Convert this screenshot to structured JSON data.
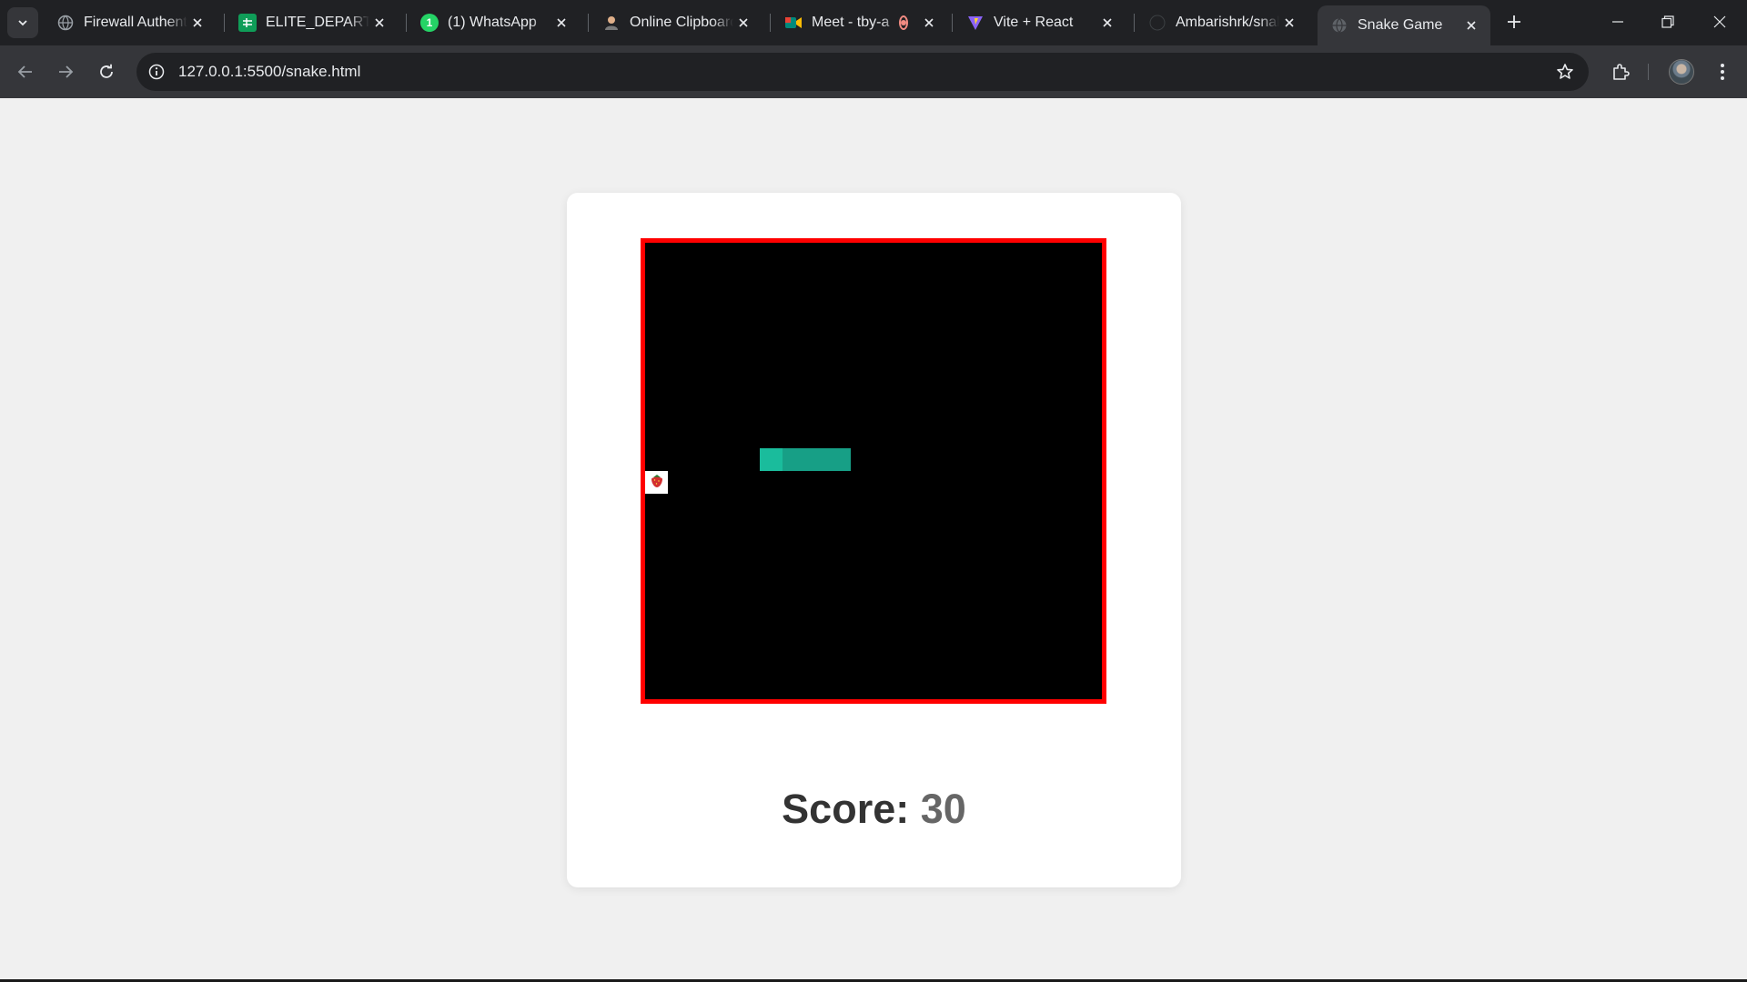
{
  "browser": {
    "tabs": [
      {
        "title": "Firewall Authenti",
        "favicon": "globe-icon",
        "active": false
      },
      {
        "title": "ELITE_DEPARTME",
        "favicon": "sheets-icon",
        "active": false
      },
      {
        "title": "(1) WhatsApp",
        "favicon": "whatsapp-icon",
        "active": false
      },
      {
        "title": "Online Clipboard",
        "favicon": "person-icon",
        "active": false
      },
      {
        "title": "Meet - tby-a",
        "favicon": "meet-icon",
        "active": false
      },
      {
        "title": "Vite + React",
        "favicon": "vite-icon",
        "active": false
      },
      {
        "title": "Ambarishrk/snak",
        "favicon": "github-icon",
        "active": false
      },
      {
        "title": "Snake Game",
        "favicon": "globe-icon",
        "active": true
      }
    ],
    "url": "127.0.0.1:5500/snake.html"
  },
  "game": {
    "grid_size": 20,
    "snake": [
      [
        5,
        9
      ],
      [
        6,
        9
      ],
      [
        7,
        9
      ],
      [
        8,
        9
      ]
    ],
    "snake_head_index": 0,
    "food": [
      0,
      10
    ],
    "food_icon": "🍓",
    "colors": {
      "board_border": "#ff0000",
      "board_bg": "#000000",
      "snake_head": "#1abc9c",
      "snake_body": "#179f86",
      "food_bg": "#ffffff"
    },
    "score_label": "Score:",
    "score_value": "30"
  }
}
